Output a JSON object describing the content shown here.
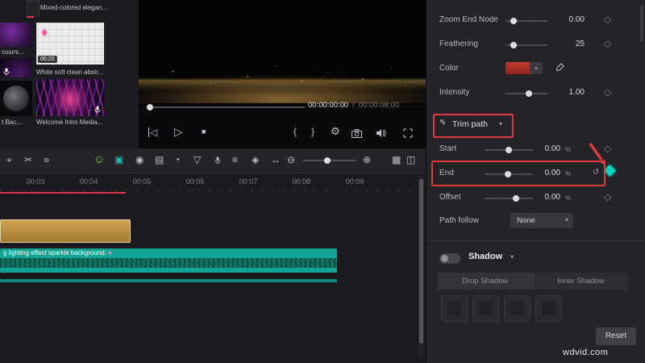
{
  "media_panel": {
    "items": [
      {
        "label": "Mixed-colored elegan..."
      },
      {
        "label": "cosmi..."
      },
      {
        "label": "White soft clean abstr...",
        "duration": "00:20"
      },
      {
        "label": "t Bac..."
      },
      {
        "label": "Welcome Intro Media..."
      }
    ]
  },
  "preview": {
    "current_time": "00:00:00:00",
    "separator": "/",
    "total_time": "00:00:08:00"
  },
  "properties": {
    "rows": [
      {
        "label": "Zoom End Node",
        "value": "0.00"
      },
      {
        "label": "Feathering",
        "value": "25"
      },
      {
        "label": "Color"
      },
      {
        "label": "Intensity",
        "value": "1.00"
      }
    ],
    "trim_path_label": "Trim path",
    "trim_rows": [
      {
        "label": "Start",
        "value": "0.00",
        "unit": "%"
      },
      {
        "label": "End",
        "value": "0.00",
        "unit": "%"
      },
      {
        "label": "Offset",
        "value": "0.00",
        "unit": "%"
      }
    ],
    "path_follow_label": "Path follow",
    "path_follow_value": "None",
    "shadow_label": "Shadow",
    "shadow_tabs": [
      "Drop Shadow",
      "Inner Shadow"
    ],
    "reset_label": "Reset"
  },
  "timeline": {
    "ruler": [
      "00:03",
      "00:04",
      "00:05",
      "00:06",
      "00:07",
      "00:08",
      "00:09"
    ],
    "clip_text": "g lighting effect sparkle background."
  },
  "watermark": "wdvid.com",
  "colors": {
    "annotation_red": "#dd3b3b",
    "active_keyframe_teal": "#00d2c0",
    "clip_gold": "#b8914a",
    "clip_teal": "#12a392",
    "color_swatch_red": "#a83232"
  },
  "icons": {
    "select": "⌖",
    "split": "✂",
    "more": "»",
    "sticker": "☺",
    "crop": "▣",
    "record": "◉",
    "import": "▤",
    "speed": "◔",
    "shield": "▽",
    "mixer": "≡",
    "keyframe": "◈",
    "transition": "↔",
    "zoom_out": "⊖",
    "zoom_in": "⊕",
    "grid": "▦",
    "layout": "◫",
    "prev": "◁",
    "play": "▷",
    "stop": "■",
    "brace_l": "{",
    "brace_r": "}",
    "gear": "⚙",
    "diamond": "◇",
    "reset_kf": "↺",
    "chevron_down": "▾",
    "gem": "♦",
    "heart": "♥",
    "pen": "✎"
  }
}
